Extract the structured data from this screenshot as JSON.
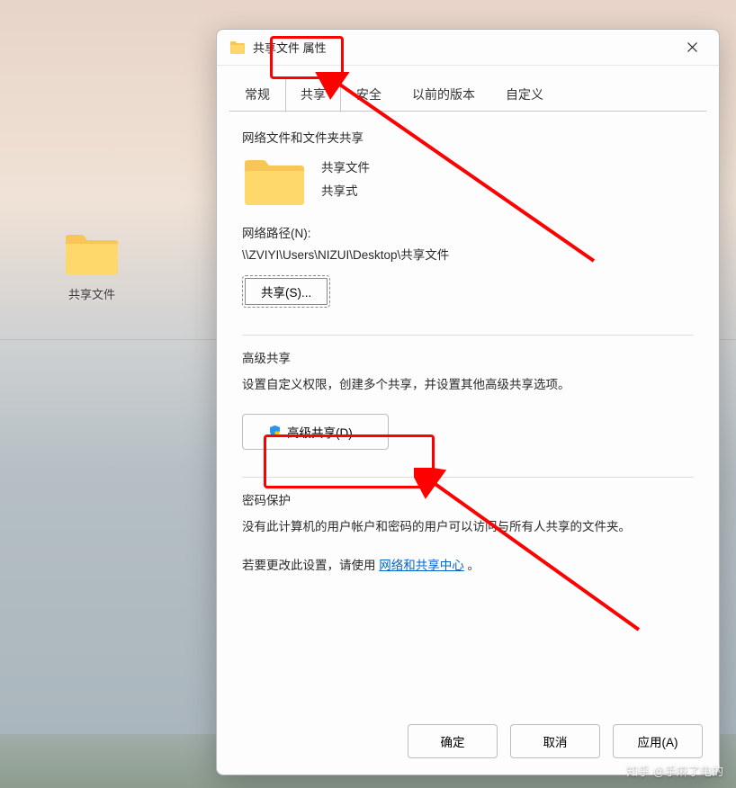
{
  "desktop": {
    "folder_label": "共享文件"
  },
  "dialog": {
    "title": "共享文件 属性",
    "tabs": [
      "常规",
      "共享",
      "安全",
      "以前的版本",
      "自定义"
    ],
    "active_tab_index": 1,
    "section1": {
      "title": "网络文件和文件夹共享",
      "folder_name": "共享文件",
      "status": "共享式",
      "path_label": "网络路径(N):",
      "path_value": "\\\\ZVIYI\\Users\\NIZUI\\Desktop\\共享文件",
      "share_button": "共享(S)..."
    },
    "section2": {
      "title": "高级共享",
      "desc": "设置自定义权限，创建多个共享，并设置其他高级共享选项。",
      "button": "高级共享(D)..."
    },
    "section3": {
      "title": "密码保护",
      "desc1": "没有此计算机的用户帐户和密码的用户可以访问与所有人共享的文件夹。",
      "desc2_prefix": "若要更改此设置，请使用",
      "link": "网络和共享中心",
      "desc2_suffix": "。"
    },
    "buttons": {
      "ok": "确定",
      "cancel": "取消",
      "apply": "应用(A)"
    }
  },
  "watermark": "知乎 @手麻了电的"
}
